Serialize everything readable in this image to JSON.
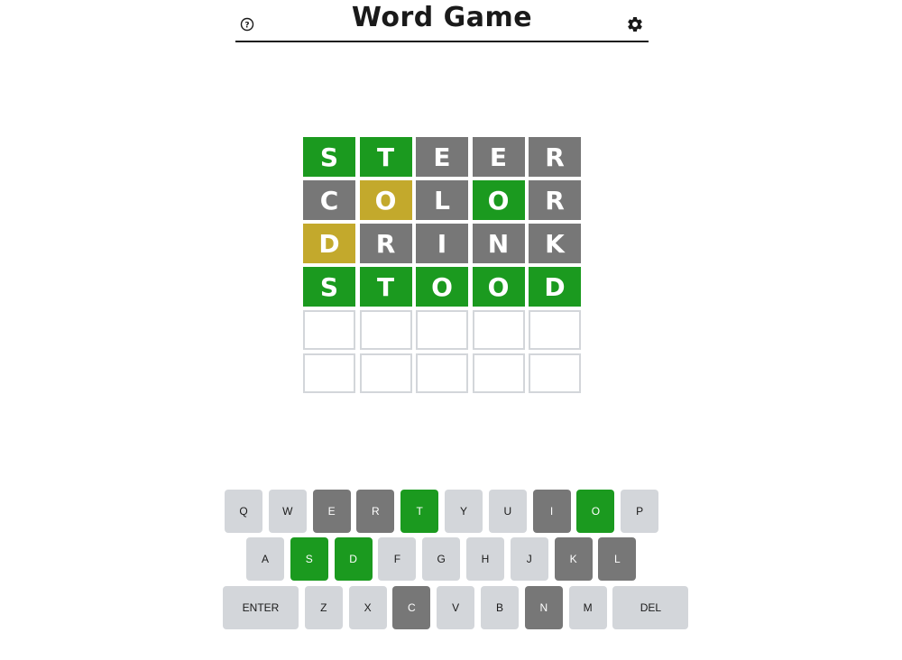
{
  "header": {
    "title": "Word Game",
    "help_icon": "help-circle-icon",
    "settings_icon": "gear-icon"
  },
  "colors": {
    "correct": "#1b9a1f",
    "present": "#c3a92c",
    "absent": "#777777",
    "unused_key": "#d3d6da",
    "empty_border": "#d3d6da"
  },
  "board": {
    "rows": [
      {
        "letters": [
          "S",
          "T",
          "E",
          "E",
          "R"
        ],
        "states": [
          "correct",
          "correct",
          "absent",
          "absent",
          "absent"
        ]
      },
      {
        "letters": [
          "C",
          "O",
          "L",
          "O",
          "R"
        ],
        "states": [
          "absent",
          "present",
          "absent",
          "correct",
          "absent"
        ]
      },
      {
        "letters": [
          "D",
          "R",
          "I",
          "N",
          "K"
        ],
        "states": [
          "present",
          "absent",
          "absent",
          "absent",
          "absent"
        ]
      },
      {
        "letters": [
          "S",
          "T",
          "O",
          "O",
          "D"
        ],
        "states": [
          "correct",
          "correct",
          "correct",
          "correct",
          "correct"
        ]
      },
      {
        "letters": [
          "",
          "",
          "",
          "",
          ""
        ],
        "states": [
          "empty",
          "empty",
          "empty",
          "empty",
          "empty"
        ]
      },
      {
        "letters": [
          "",
          "",
          "",
          "",
          ""
        ],
        "states": [
          "empty",
          "empty",
          "empty",
          "empty",
          "empty"
        ]
      }
    ]
  },
  "keyboard": {
    "rows": [
      [
        {
          "label": "Q",
          "state": "unused"
        },
        {
          "label": "W",
          "state": "unused"
        },
        {
          "label": "E",
          "state": "absent"
        },
        {
          "label": "R",
          "state": "absent"
        },
        {
          "label": "T",
          "state": "correct"
        },
        {
          "label": "Y",
          "state": "unused"
        },
        {
          "label": "U",
          "state": "unused"
        },
        {
          "label": "I",
          "state": "absent"
        },
        {
          "label": "O",
          "state": "correct"
        },
        {
          "label": "P",
          "state": "unused"
        }
      ],
      [
        {
          "label": "A",
          "state": "unused"
        },
        {
          "label": "S",
          "state": "correct"
        },
        {
          "label": "D",
          "state": "correct"
        },
        {
          "label": "F",
          "state": "unused"
        },
        {
          "label": "G",
          "state": "unused"
        },
        {
          "label": "H",
          "state": "unused"
        },
        {
          "label": "J",
          "state": "unused"
        },
        {
          "label": "K",
          "state": "absent"
        },
        {
          "label": "L",
          "state": "absent"
        }
      ],
      [
        {
          "label": "ENTER",
          "state": "unused"
        },
        {
          "label": "Z",
          "state": "unused"
        },
        {
          "label": "X",
          "state": "unused"
        },
        {
          "label": "C",
          "state": "absent"
        },
        {
          "label": "V",
          "state": "unused"
        },
        {
          "label": "B",
          "state": "unused"
        },
        {
          "label": "N",
          "state": "absent"
        },
        {
          "label": "M",
          "state": "unused"
        },
        {
          "label": "DEL",
          "state": "unused"
        }
      ]
    ]
  }
}
